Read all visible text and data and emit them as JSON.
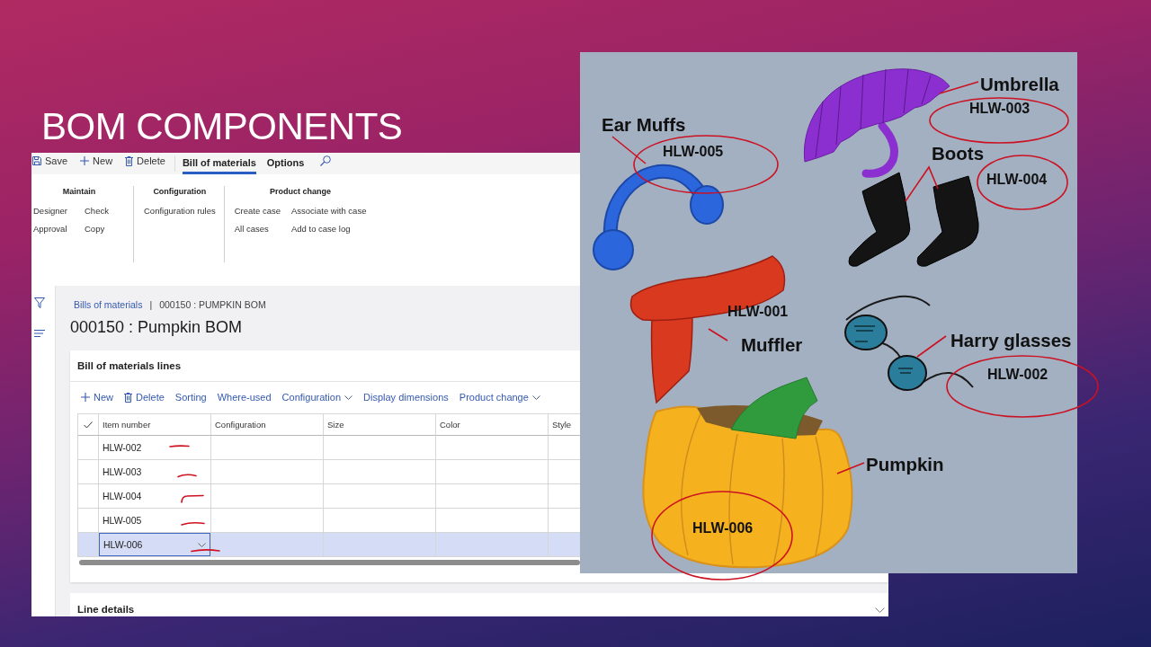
{
  "slide": {
    "title": "BOM COMPONENTS"
  },
  "app": {
    "actions": [
      {
        "label": "Save",
        "kind": "save"
      },
      {
        "label": "New",
        "kind": "new"
      },
      {
        "label": "Delete",
        "kind": "delete"
      }
    ],
    "tabs": [
      {
        "label": "Bill of materials",
        "selected": true
      },
      {
        "label": "Options",
        "selected": false
      }
    ],
    "ribbon_groups": [
      {
        "title": "Maintain",
        "columns": [
          [
            "Designer",
            "Approval"
          ],
          [
            "Check",
            "Copy"
          ]
        ]
      },
      {
        "title": "Configuration",
        "columns": [
          [
            "Configuration rules"
          ]
        ]
      },
      {
        "title": "Product change",
        "columns": [
          [
            "Create case",
            "All cases"
          ],
          [
            "Associate with case",
            "Add to case log"
          ]
        ]
      }
    ],
    "breadcrumb": {
      "link": "Bills of materials",
      "separator": "|",
      "current": "000150 : PUMPKIN BOM"
    },
    "page_title": "000150 : Pumpkin BOM",
    "lines": {
      "title": "Bill of materials lines",
      "toolbar": [
        {
          "label": "New",
          "kind": "new"
        },
        {
          "label": "Delete",
          "kind": "delete"
        },
        {
          "label": "Sorting",
          "kind": "plain"
        },
        {
          "label": "Where-used",
          "kind": "plain"
        },
        {
          "label": "Configuration",
          "kind": "menu"
        },
        {
          "label": "Display dimensions",
          "kind": "plain"
        },
        {
          "label": "Product change",
          "kind": "menu"
        }
      ],
      "table": {
        "columns": [
          "Item number",
          "Configuration",
          "Size",
          "Color",
          "Style"
        ],
        "rows": [
          {
            "item_number": "HLW-002",
            "selected": false,
            "underlined": true
          },
          {
            "item_number": "HLW-003",
            "selected": false,
            "underlined": true
          },
          {
            "item_number": "HLW-004",
            "selected": false,
            "underlined": true
          },
          {
            "item_number": "HLW-005",
            "selected": false,
            "underlined": true
          },
          {
            "item_number": "HLW-006",
            "selected": true,
            "underlined": true
          }
        ]
      }
    },
    "line_details": {
      "title": "Line details",
      "expanded": false
    }
  },
  "drawing": {
    "items": [
      {
        "label": "Ear Muffs",
        "code": "HLW-005",
        "kind": "earmuffs",
        "circled": true
      },
      {
        "label": "Umbrella",
        "code": "HLW-003",
        "kind": "umbrella",
        "circled": true
      },
      {
        "label": "Boots",
        "code": "HLW-004",
        "kind": "boots",
        "circled": true
      },
      {
        "label": "Muffler",
        "code": "HLW-001",
        "kind": "scarf",
        "circled": false
      },
      {
        "label": "Harry glasses",
        "code": "HLW-002",
        "kind": "glasses",
        "circled": true
      },
      {
        "label": "Pumpkin",
        "code": "HLW-006",
        "kind": "pumpkin",
        "circled": true
      }
    ]
  }
}
